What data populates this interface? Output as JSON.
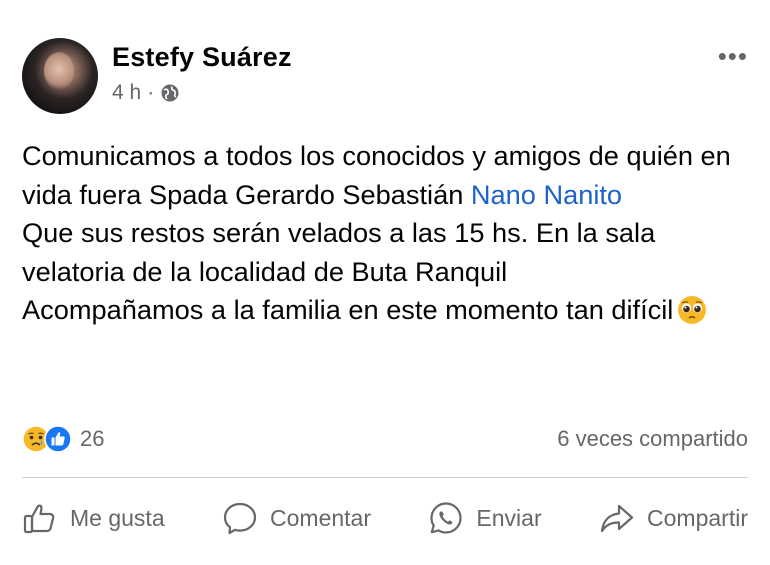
{
  "post": {
    "author": "Estefy Suárez",
    "time": "4 h",
    "separator": "·",
    "visibility_icon": "globe-icon",
    "more_label": "•••",
    "text": {
      "line1": "Comunicamos a todos los conocidos y amigos de quién en vida fuera Spada Gerardo Sebastián ",
      "mention": "Nano Nanito",
      "line2": "Que sus restos serán velados a las 15 hs. En la sala velatoria de la localidad de Buta Ranquil",
      "line3": "Acompañamos a la familia en este momento tan difícil"
    },
    "emoji_icon": "pleading-face-icon",
    "reactions": {
      "icons": [
        "sad-reaction-icon",
        "like-reaction-icon"
      ],
      "count": "26"
    },
    "shares": "6 veces compartido"
  },
  "actions": {
    "like_label": "Me gusta",
    "comment_label": "Comentar",
    "send_label": "Enviar",
    "share_label": "Compartir"
  },
  "colors": {
    "mention": "#1b63c9",
    "secondary_text": "#65676b",
    "like_blue": "#1877f2",
    "sad_yellow": "#f7b928"
  }
}
